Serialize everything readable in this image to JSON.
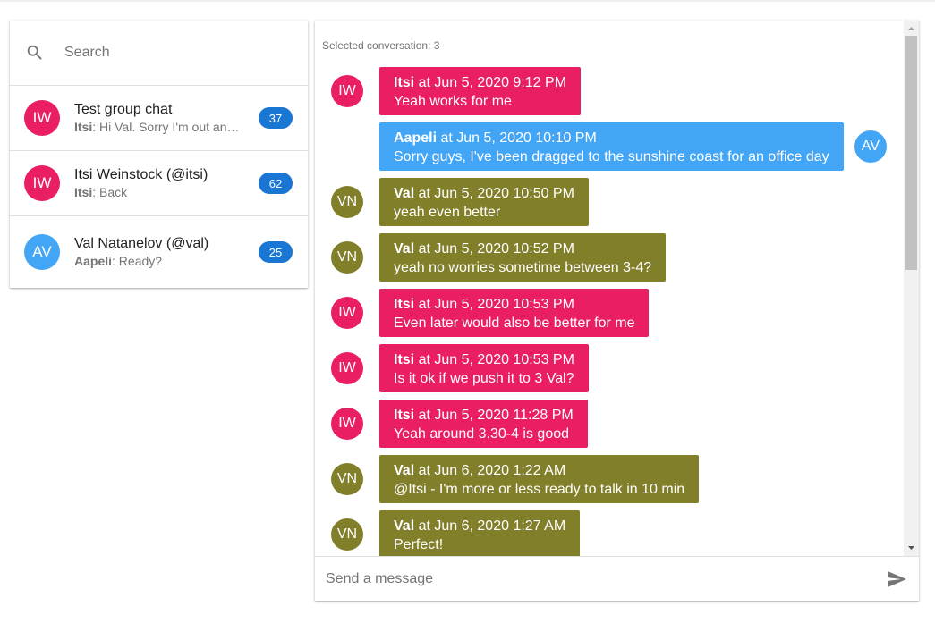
{
  "colors": {
    "itsi": "#e91e63",
    "aapeli": "#42a5f5",
    "val": "#827f2a",
    "badge": "#1976d2"
  },
  "search": {
    "placeholder": "Search"
  },
  "conversations": [
    {
      "initials": "IW",
      "title": "Test group chat",
      "sender": "Itsi",
      "preview": ": Hi Val. Sorry I'm out and about",
      "badge": "37",
      "color": "#e91e63"
    },
    {
      "initials": "IW",
      "title": "Itsi Weinstock (@itsi)",
      "sender": "Itsi",
      "preview": ": Back",
      "badge": "62",
      "color": "#e91e63"
    },
    {
      "initials": "AV",
      "title": "Val Natanelov (@val)",
      "sender": "Aapeli",
      "preview": ": Ready?",
      "badge": "25",
      "color": "#42a5f5"
    }
  ],
  "chat": {
    "selected_label": "Selected conversation: 3",
    "messages": [
      {
        "author": "Itsi",
        "initials": "IW",
        "time": " at Jun 5, 2020 9:12 PM",
        "text": "Yeah works for me",
        "side": "left",
        "color": "#e91e63"
      },
      {
        "author": "Aapeli",
        "initials": "AV",
        "time": " at Jun 5, 2020 10:10 PM",
        "text": "Sorry guys, I've been dragged to the sunshine coast for an office day",
        "side": "right",
        "color": "#42a5f5"
      },
      {
        "author": "Val",
        "initials": "VN",
        "time": " at Jun 5, 2020 10:50 PM",
        "text": "yeah even better",
        "side": "left",
        "color": "#827f2a"
      },
      {
        "author": "Val",
        "initials": "VN",
        "time": " at Jun 5, 2020 10:52 PM",
        "text": "yeah no worries sometime between 3-4?",
        "side": "left",
        "color": "#827f2a"
      },
      {
        "author": "Itsi",
        "initials": "IW",
        "time": " at Jun 5, 2020 10:53 PM",
        "text": "Even later would also be better for me",
        "side": "left",
        "color": "#e91e63"
      },
      {
        "author": "Itsi",
        "initials": "IW",
        "time": " at Jun 5, 2020 10:53 PM",
        "text": "Is it ok if we push it to 3 Val?",
        "side": "left",
        "color": "#e91e63"
      },
      {
        "author": "Itsi",
        "initials": "IW",
        "time": " at Jun 5, 2020 11:28 PM",
        "text": "Yeah around 3.30-4 is good",
        "side": "left",
        "color": "#e91e63"
      },
      {
        "author": "Val",
        "initials": "VN",
        "time": " at Jun 6, 2020 1:22 AM",
        "text": "@Itsi - I'm more or less ready to talk in 10 min",
        "side": "left",
        "color": "#827f2a"
      },
      {
        "author": "Val",
        "initials": "VN",
        "time": " at Jun 6, 2020 1:27 AM",
        "text": "Perfect!",
        "side": "left",
        "color": "#827f2a"
      }
    ]
  },
  "compose": {
    "placeholder": "Send a message"
  },
  "icons": {
    "search": "search-icon",
    "send": "send-icon",
    "scroll_up": "arrow-up-icon",
    "scroll_down": "arrow-down-icon"
  }
}
